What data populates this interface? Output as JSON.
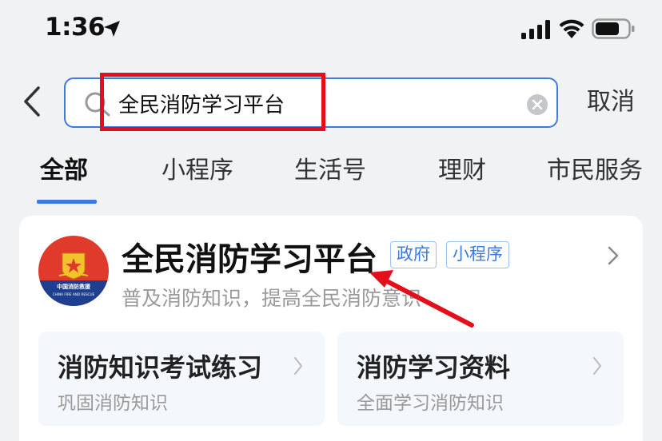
{
  "status_bar": {
    "time": "1:36",
    "icons": [
      "location-arrow-icon",
      "signal-icon",
      "wifi-icon",
      "battery-icon"
    ]
  },
  "search": {
    "back_icon": "chevron-left-icon",
    "search_icon": "search-icon",
    "value": "全民消防学习平台",
    "clear_icon": "clear-icon",
    "cancel_label": "取消",
    "accent_color": "#3d7ae0"
  },
  "tabs": [
    {
      "label": "全部",
      "active": true
    },
    {
      "label": "小程序",
      "active": false
    },
    {
      "label": "生活号",
      "active": false
    },
    {
      "label": "理财",
      "active": false
    },
    {
      "label": "市民服务",
      "active": false
    }
  ],
  "result": {
    "title": "全民消防学习平台",
    "tags": [
      "政府",
      "小程序"
    ],
    "subtitle": "普及消防知识，提高全民消防意识",
    "logo_icon": "fire-rescue-emblem-icon",
    "logo_text": "中国消防救援",
    "services": [
      {
        "title": "消防知识考试练习",
        "desc": "巩固消防知识"
      },
      {
        "title": "消防学习资料",
        "desc": "全面学习消防知识"
      }
    ]
  },
  "annotations": {
    "highlight_color": "#e3101c"
  }
}
